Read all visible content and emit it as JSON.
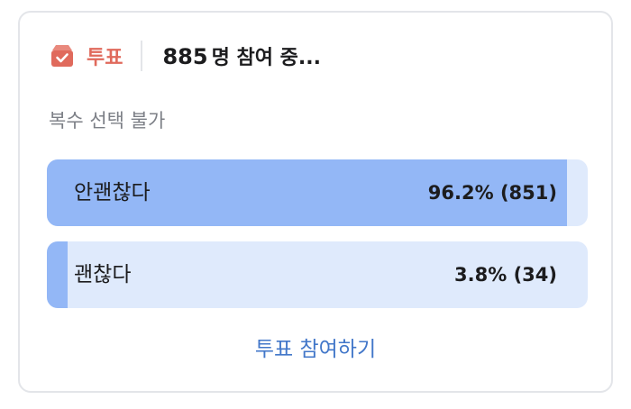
{
  "poll": {
    "icon": "ballot-box-icon",
    "label": "투표",
    "participants": {
      "count": "885",
      "suffix": "명 참여 중..."
    },
    "selection_rule": "복수 선택 불가",
    "options": [
      {
        "label": "안괜찮다",
        "result": "96.2% (851)",
        "percent": 96.2
      },
      {
        "label": "괜찮다",
        "result": "3.8% (34)",
        "percent": 3.8
      }
    ],
    "join_label": "투표 참여하기"
  },
  "colors": {
    "accent_red": "#e06a5c",
    "bar_fill": "#93b7f6",
    "bar_track": "#dfeafc",
    "link_blue": "#4277c9"
  }
}
